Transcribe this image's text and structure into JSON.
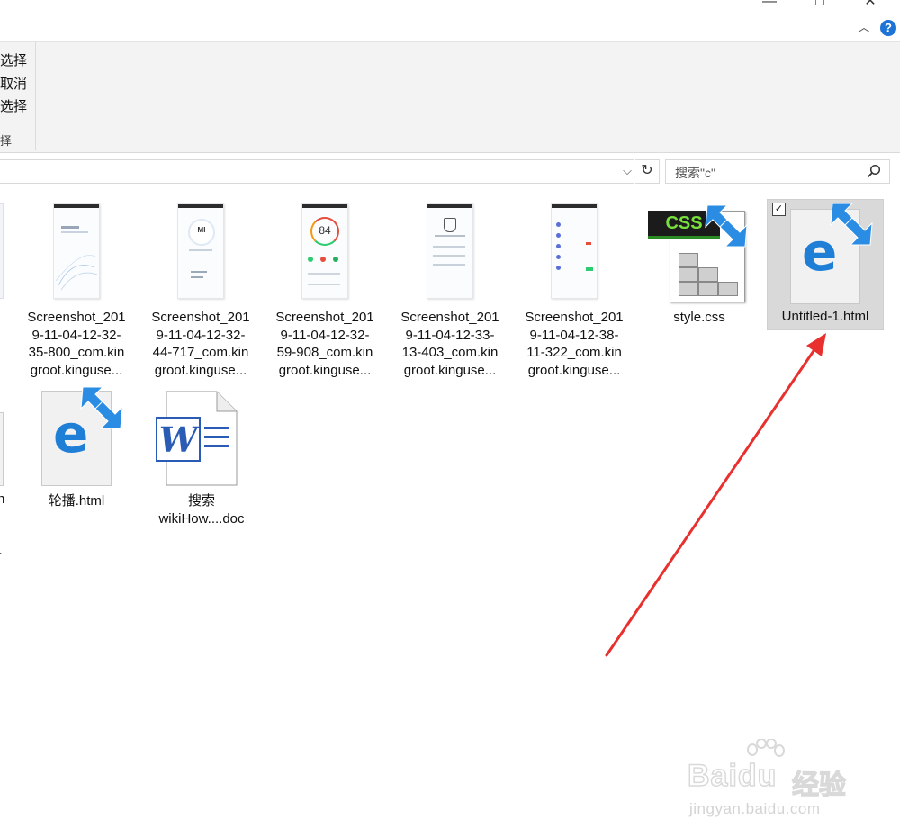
{
  "window": {
    "minimize": "—",
    "maximize": "□",
    "close": "✕"
  },
  "ribbon": {
    "items": [
      "选择",
      "取消",
      "选择",
      "择"
    ],
    "collapse_icon": "chevron-up-icon",
    "help_label": "?"
  },
  "address": {
    "path": "",
    "refresh_icon": "refresh-icon",
    "search_placeholder": "搜索\"c\""
  },
  "files": [
    {
      "name": "Screenshot_2019-11-04-12-32-35-800_com.kingroot.kinguse...",
      "label": "Screenshot_201\n9-11-04-12-32-\n35-800_com.kin\ngroot.kinguse...",
      "type": "image"
    },
    {
      "name": "Screenshot_2019-11-04-12-32-44-717_com.kingroot.kinguse...",
      "label": "Screenshot_201\n9-11-04-12-32-\n44-717_com.kin\ngroot.kinguse...",
      "type": "image",
      "thumb_text": "MI"
    },
    {
      "name": "Screenshot_2019-11-04-12-32-59-908_com.kingroot.kinguse...",
      "label": "Screenshot_201\n9-11-04-12-32-\n59-908_com.kin\ngroot.kinguse...",
      "type": "image",
      "thumb_text": "84"
    },
    {
      "name": "Screenshot_2019-11-04-12-33-13-403_com.kingroot.kinguse...",
      "label": "Screenshot_201\n9-11-04-12-33-\n13-403_com.kin\ngroot.kinguse...",
      "type": "image"
    },
    {
      "name": "Screenshot_2019-11-04-12-38-11-322_com.kingroot.kinguse...",
      "label": "Screenshot_201\n9-11-04-12-38-\n11-322_com.kin\ngroot.kinguse...",
      "type": "image"
    },
    {
      "name": "style.css",
      "label": "style.css",
      "type": "css",
      "badge": "CSS"
    },
    {
      "name": "Untitled-1.html",
      "label": "Untitled-1.html",
      "type": "html",
      "selected": true,
      "checked": true
    },
    {
      "name": "轮播.html",
      "label": "轮播.html",
      "type": "html"
    },
    {
      "name": "搜索wikiHow....doc",
      "label": "搜索\nwikiHow....doc",
      "type": "doc"
    }
  ],
  "left_cut_labels": [
    "n",
    "i",
    "-"
  ],
  "watermark": {
    "brand": "Baidu",
    "cn": "经验",
    "url": "jingyan.baidu.com"
  },
  "colors": {
    "accent": "#1e73d6",
    "selected_bg": "#d9d9d9",
    "arrow": "#e8312f",
    "edge_blue": "#1f7fd6",
    "css_green": "#2c8a23"
  }
}
